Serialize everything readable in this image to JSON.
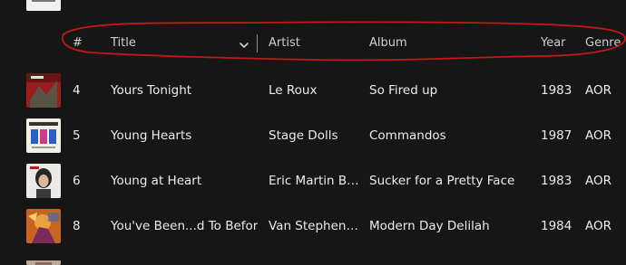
{
  "columns": {
    "number": "#",
    "title": "Title",
    "artist": "Artist",
    "album": "Album",
    "year": "Year",
    "genre": "Genre"
  },
  "sort_icon": "chevron-down-icon",
  "annotation_color": "#c0181b",
  "tracks": [
    {
      "number": "4",
      "title": "Yours Tonight",
      "artist": "Le Roux",
      "album": "So Fired up",
      "year": "1983",
      "genre": "AOR"
    },
    {
      "number": "5",
      "title": "Young Hearts",
      "artist": "Stage Dolls",
      "album": "Commandos",
      "year": "1987",
      "genre": "AOR"
    },
    {
      "number": "6",
      "title": "Young at Heart",
      "artist": "Eric Martin Ba...",
      "album": "Sucker for a Pretty Face",
      "year": "1983",
      "genre": "AOR"
    },
    {
      "number": "8",
      "title": "You've Been...d To Before",
      "artist": "Van Stephens...",
      "album": "Modern Day Delilah",
      "year": "1984",
      "genre": "AOR"
    }
  ]
}
